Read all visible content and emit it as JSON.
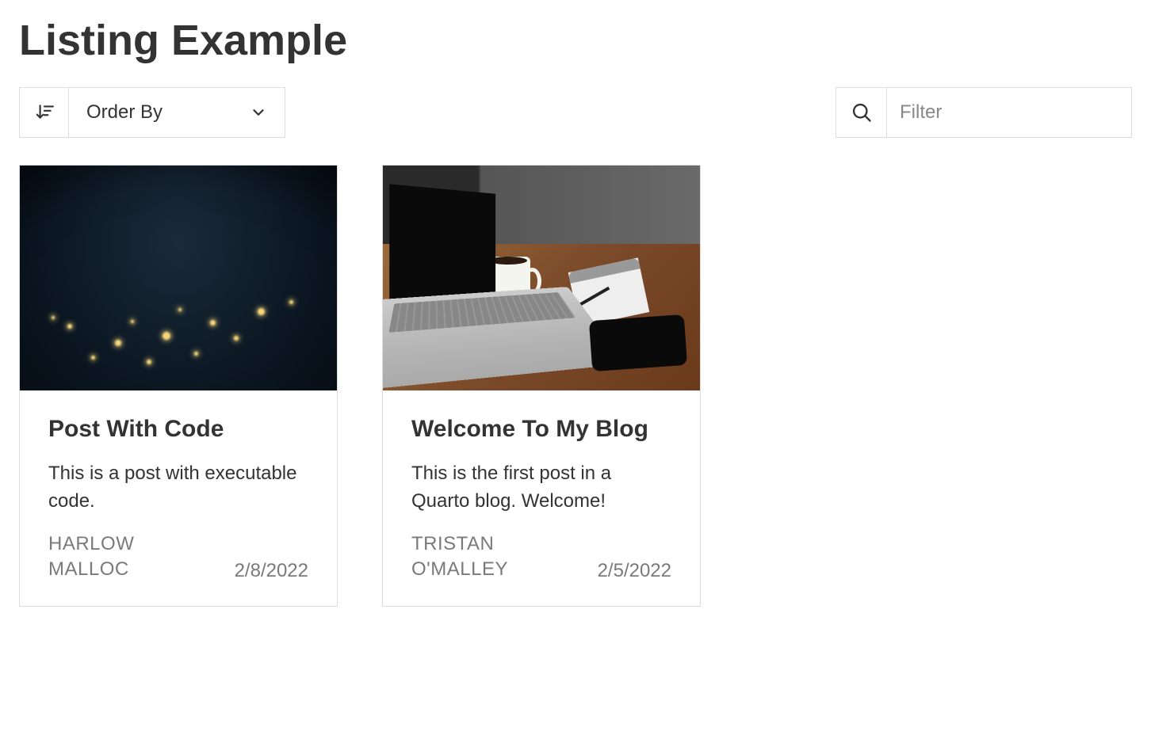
{
  "page": {
    "title": "Listing Example"
  },
  "controls": {
    "order_by_label": "Order By",
    "filter_placeholder": "Filter",
    "filter_value": ""
  },
  "posts": [
    {
      "title": "Post With Code",
      "description": "This is a post with executable code.",
      "author": "HARLOW MALLOC",
      "date": "2/8/2022",
      "image": "earth"
    },
    {
      "title": "Welcome To My Blog",
      "description": "This is the first post in a Quarto blog. Welcome!",
      "author": "TRISTAN O'MALLEY",
      "date": "2/5/2022",
      "image": "desk"
    }
  ]
}
